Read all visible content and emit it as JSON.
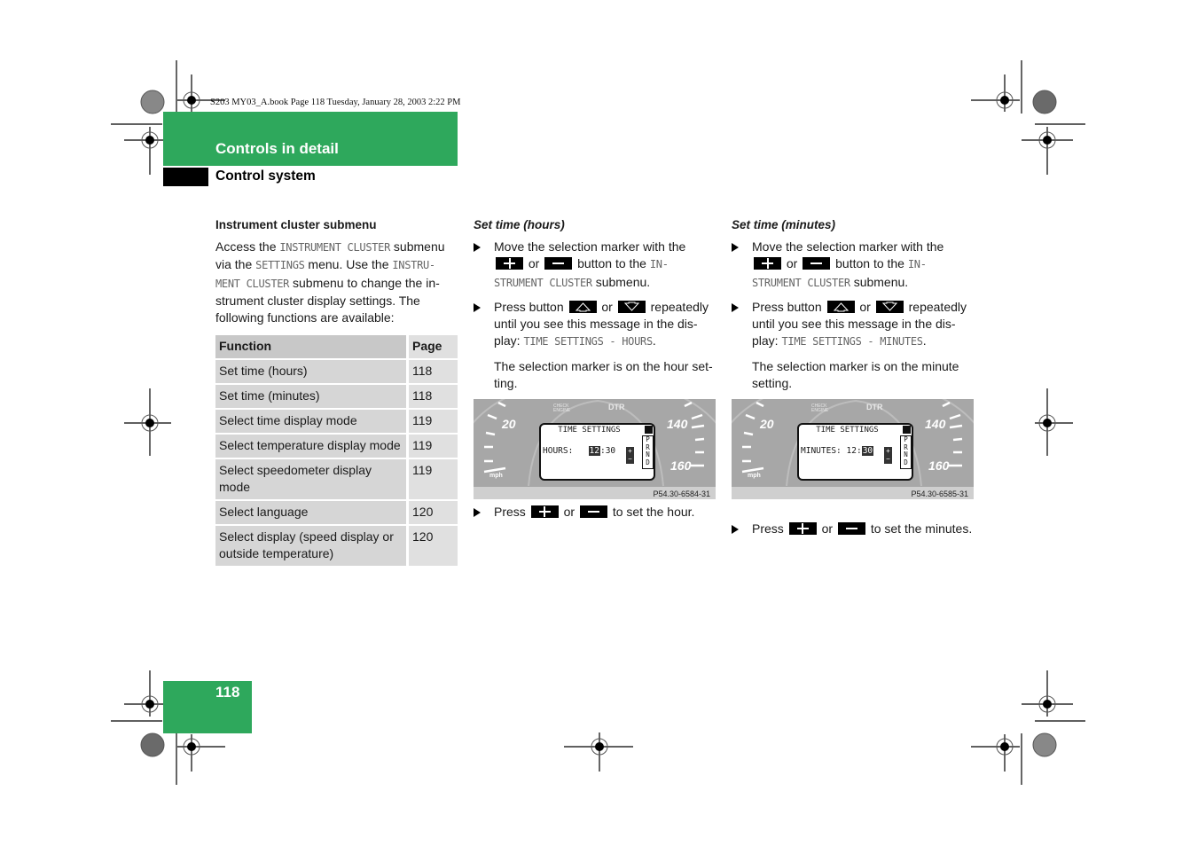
{
  "slug": "S203 MY03_A.book  Page 118  Tuesday, January 28, 2003  2:22 PM",
  "header": {
    "section": "Controls in detail",
    "subsection": "Control system"
  },
  "intro": {
    "heading": "Instrument cluster submenu",
    "p1_a": "Access the ",
    "p1_mono1": "INSTRUMENT CLUSTER",
    "p1_b": " submenu via the ",
    "p1_mono2": "SETTINGS",
    "p1_c": " menu. Use the ",
    "p1_mono3": "INSTRU-MENT CLUSTER",
    "p1_d": " submenu to change the in-strument cluster display settings. The following functions are available:"
  },
  "table": {
    "headers": [
      "Function",
      "Page"
    ],
    "rows": [
      {
        "function": "Set time (hours)",
        "page": "118"
      },
      {
        "function": "Set time (minutes)",
        "page": "118"
      },
      {
        "function": "Select time display mode",
        "page": "119"
      },
      {
        "function": "Select temperature display mode",
        "page": "119"
      },
      {
        "function": "Select speedometer display mode",
        "page": "119"
      },
      {
        "function": "Select language",
        "page": "120"
      },
      {
        "function": "Select display (speed display or outside temperature)",
        "page": "120"
      }
    ]
  },
  "hours": {
    "heading": "Set time (hours)",
    "step1_a": "Move the selection marker with the",
    "or": "or",
    "step1_b": "button to the",
    "step1_mono": "IN-STRUMENT CLUSTER",
    "step1_c": "submenu.",
    "step2_a": "Press button",
    "step2_b": "repeatedly until you see this message in the dis-play:",
    "step2_mono": "TIME SETTINGS - HOURS",
    "note": "The selection marker is on the hour set-ting.",
    "display": {
      "title": "TIME SETTINGS",
      "label": "HOURS:",
      "hour": "12",
      "sep": ":",
      "minute": "30",
      "selected": "hour",
      "gear": [
        "P",
        "R",
        "N",
        "D"
      ],
      "speed_left": "20",
      "speed_right_top": "140",
      "speed_right_bottom": "160",
      "unit": "mph",
      "warn_check": "CHECK ENGINE",
      "warn_dtr": "DTR",
      "figure_code": "P54.30-6584-31"
    },
    "step3_a": "Press",
    "step3_b": "to set the hour."
  },
  "minutes": {
    "heading": "Set time (minutes)",
    "step1_a": "Move the selection marker with the",
    "or": "or",
    "step1_b": "button to the",
    "step1_mono": "IN-STRUMENT CLUSTER",
    "step1_c": "submenu.",
    "step2_a": "Press button",
    "step2_b": "repeatedly until you see this message in the dis-play:",
    "step2_mono": "TIME SETTINGS - MINUTES",
    "note": "The selection marker is on the minute setting.",
    "display": {
      "title": "TIME SETTINGS",
      "label": "MINUTES:",
      "hour": "12",
      "sep": ":",
      "minute": "30",
      "selected": "minute",
      "gear": [
        "P",
        "R",
        "N",
        "D"
      ],
      "speed_left": "20",
      "speed_right_top": "140",
      "speed_right_bottom": "160",
      "unit": "mph",
      "warn_check": "CHECK ENGINE",
      "warn_dtr": "DTR",
      "figure_code": "P54.30-6585-31"
    },
    "step3_a": "Press",
    "step3_b": "to set the minutes."
  },
  "footer": {
    "page_number": "118"
  },
  "colors": {
    "brand_green": "#2ea85c",
    "table_function_bg": "#d6d6d6",
    "table_page_bg": "#e0e0e0",
    "table_header_bg": "#c8c8c8"
  }
}
